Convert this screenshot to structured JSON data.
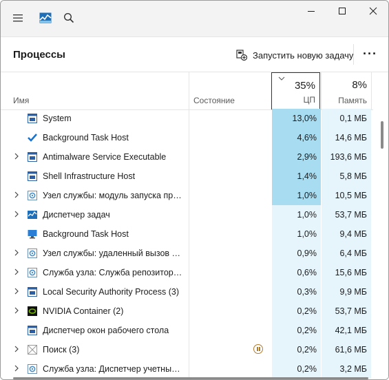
{
  "window": {
    "title_icon": "task-manager-icon"
  },
  "header": {
    "title": "Процессы",
    "run_task_label": "Запустить новую задачу",
    "more_label": "···"
  },
  "columns": {
    "name": "Имя",
    "status": "Состояние",
    "cpu_total": "35%",
    "cpu": "ЦП",
    "mem_total": "8%",
    "mem": "Память"
  },
  "colors": {
    "cpu_high": "#a8dcf0",
    "cpu_low": "#e6f4fb",
    "mem_bg": "#e6f4fb"
  },
  "processes": [
    {
      "expand": false,
      "icon": "window-app-icon",
      "name": "System",
      "cpu": "13,0%",
      "mem": "0,1 МБ",
      "high": true
    },
    {
      "expand": false,
      "icon": "checkmark-icon",
      "name": "Background Task Host",
      "cpu": "4,6%",
      "mem": "14,6 МБ",
      "high": true
    },
    {
      "expand": true,
      "icon": "window-app-icon",
      "name": "Antimalware Service Executable",
      "cpu": "2,9%",
      "mem": "193,6 МБ",
      "high": true
    },
    {
      "expand": false,
      "icon": "window-app-icon",
      "name": "Shell Infrastructure Host",
      "cpu": "1,4%",
      "mem": "5,8 МБ",
      "high": true
    },
    {
      "expand": true,
      "icon": "gear-icon",
      "name": "Узел службы: модуль запуска процессов сервера DCOM",
      "cpu": "1,0%",
      "mem": "10,5 МБ",
      "high": true
    },
    {
      "expand": true,
      "icon": "task-manager-icon",
      "name": "Диспетчер задач",
      "cpu": "1,0%",
      "mem": "53,7 МБ",
      "high": false
    },
    {
      "expand": false,
      "icon": "monitor-icon",
      "name": "Background Task Host",
      "cpu": "1,0%",
      "mem": "9,4 МБ",
      "high": false
    },
    {
      "expand": true,
      "icon": "gear-icon",
      "name": "Узел службы: удаленный вызов процедур",
      "cpu": "0,9%",
      "mem": "6,4 МБ",
      "high": false
    },
    {
      "expand": true,
      "icon": "gear-icon",
      "name": "Служба узла: Служба репозитория состояний",
      "cpu": "0,6%",
      "mem": "15,6 МБ",
      "high": false
    },
    {
      "expand": true,
      "icon": "window-app-icon",
      "name": "Local Security Authority Process (3)",
      "cpu": "0,3%",
      "mem": "9,9 МБ",
      "high": false
    },
    {
      "expand": true,
      "icon": "nvidia-icon",
      "name": "NVIDIA Container (2)",
      "cpu": "0,2%",
      "mem": "53,7 МБ",
      "high": false
    },
    {
      "expand": false,
      "icon": "window-app-icon",
      "name": "Диспетчер окон рабочего стола",
      "cpu": "0,2%",
      "mem": "42,1 МБ",
      "high": false
    },
    {
      "expand": true,
      "icon": "search-app-icon",
      "name": "Поиск (3)",
      "cpu": "0,2%",
      "mem": "61,6 МБ",
      "high": false,
      "paused": true
    },
    {
      "expand": true,
      "icon": "gear-icon",
      "name": "Служба узла: Диспетчер учетных в...",
      "cpu": "0,2%",
      "mem": "3,2 МБ",
      "high": false
    }
  ]
}
